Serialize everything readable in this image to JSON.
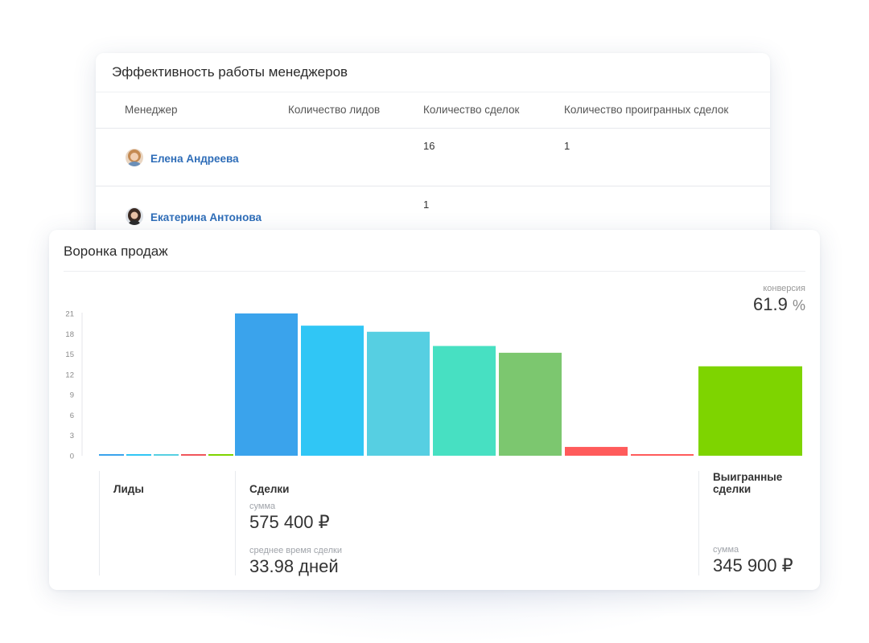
{
  "managers": {
    "title": "Эффективность работы менеджеров",
    "columns": [
      "Менеджер",
      "Количество лидов",
      "Количество сделок",
      "Количество проигранных сделок"
    ],
    "rows": [
      {
        "name": "Елена Андреева",
        "leads": "",
        "deals": "16",
        "lost": "1"
      },
      {
        "name": "Екатерина Антонова",
        "leads": "",
        "deals": "1",
        "lost": ""
      }
    ]
  },
  "funnel": {
    "title": "Воронка продаж",
    "conversion_label": "конверсия",
    "conversion_value": "61.9",
    "conversion_unit": "%",
    "sections": {
      "leads": {
        "title": "Лиды"
      },
      "deals": {
        "title": "Сделки",
        "sum_label": "сумма",
        "sum_value": "575 400 ₽",
        "avg_label": "среднее время сделки",
        "avg_value": "33.98 дней"
      },
      "won": {
        "title_line1": "Выигранные",
        "title_line2": "сделки",
        "sum_label": "сумма",
        "sum_value": "345 900 ₽"
      }
    }
  },
  "chart_data": {
    "type": "bar",
    "yticks": [
      0,
      3,
      6,
      9,
      12,
      15,
      18,
      21
    ],
    "ylim": [
      0,
      21
    ],
    "grid": false,
    "groups": [
      {
        "name": "Лиды",
        "values": [
          0.2,
          0.2,
          0.2,
          0.2,
          0.2
        ],
        "colors": [
          "#3aa3ec",
          "#30c6f5",
          "#56cfe2",
          "#f0555a",
          "#7ed400"
        ]
      },
      {
        "name": "Сделки",
        "values": [
          21,
          19.2,
          18.3,
          16.2,
          15.2,
          1.3,
          0.2
        ],
        "colors": [
          "#3aa3ec",
          "#30c6f5",
          "#56cfe2",
          "#47e0c2",
          "#7cc76f",
          "#ff5b5b",
          "#ff5b5b"
        ]
      },
      {
        "name": "Выигранные сделки",
        "values": [
          13.2
        ],
        "colors": [
          "#7ed400"
        ]
      }
    ]
  }
}
